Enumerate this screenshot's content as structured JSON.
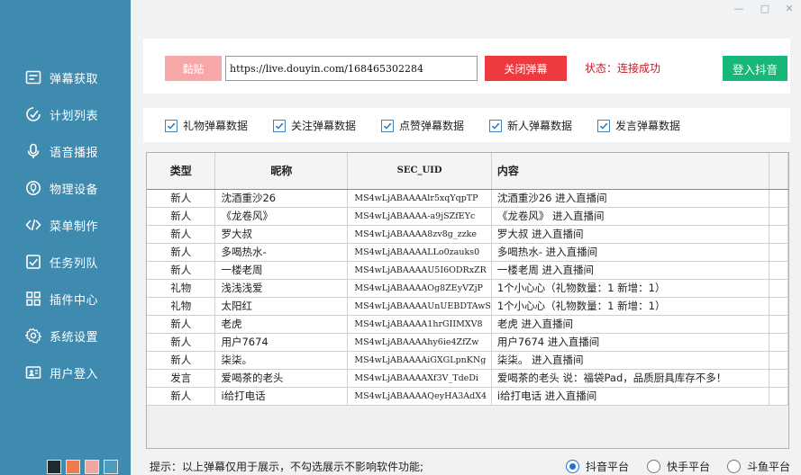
{
  "window": {
    "min_glyph": "—",
    "max_glyph": "□",
    "close_glyph": "✕"
  },
  "sidebar": {
    "items": [
      {
        "label": "弹幕获取",
        "icon": "danmaku-icon"
      },
      {
        "label": "计划列表",
        "icon": "plan-list-icon"
      },
      {
        "label": "语音播报",
        "icon": "microphone-icon"
      },
      {
        "label": "物理设备",
        "icon": "device-icon"
      },
      {
        "label": "菜单制作",
        "icon": "code-icon"
      },
      {
        "label": "任务列队",
        "icon": "task-queue-icon"
      },
      {
        "label": "插件中心",
        "icon": "plugin-grid-icon"
      },
      {
        "label": "系统设置",
        "icon": "gear-icon"
      },
      {
        "label": "用户登入",
        "icon": "user-card-icon"
      }
    ],
    "swatches": [
      "#1f2a33",
      "#f07b4a",
      "#f0a7a0",
      "#4f9bbd"
    ]
  },
  "top": {
    "paste_label": "黏贴",
    "url_value": "https://live.douyin.com/168465302284",
    "close_label": "关闭弹幕",
    "status_text": "状态：连接成功",
    "login_label": "登入抖音",
    "colors": {
      "paste": "#f7a7a8",
      "close": "#ee3a3f",
      "login": "#17b877",
      "status": "#c0202a"
    }
  },
  "filters": [
    {
      "label": "礼物弹幕数据",
      "checked": true
    },
    {
      "label": "关注弹幕数据",
      "checked": true
    },
    {
      "label": "点赞弹幕数据",
      "checked": true
    },
    {
      "label": "新人弹幕数据",
      "checked": true
    },
    {
      "label": "发言弹幕数据",
      "checked": true
    }
  ],
  "table": {
    "headers": [
      "类型",
      "昵称",
      "SEC_UID",
      "内容"
    ],
    "rows": [
      [
        "新人",
        "沈酒重沙26",
        "MS4wLjABAAAAlr5xqYqpTP",
        "沈酒重沙26 进入直播间"
      ],
      [
        "新人",
        "《龙卷风》",
        "MS4wLjABAAAA-a9jSZfEYc",
        "《龙卷风》 进入直播间"
      ],
      [
        "新人",
        "罗大叔",
        "MS4wLjABAAAA8zv8g_zzke",
        "罗大叔 进入直播间"
      ],
      [
        "新人",
        "多喝热水-",
        "MS4wLjABAAAALLo0zauks0",
        "多喝热水- 进入直播间"
      ],
      [
        "新人",
        "一楼老周",
        "MS4wLjABAAAAU5I6ODRxZR",
        "一楼老周 进入直播间"
      ],
      [
        "礼物",
        "浅浅浅爱",
        "MS4wLjABAAAAOg8ZEyVZjP",
        "1个小心心（礼物数量：1 新增：1）"
      ],
      [
        "礼物",
        "太阳红",
        "MS4wLjABAAAAUnUEBDTAwS",
        "1个小心心（礼物数量：1 新增：1）"
      ],
      [
        "新人",
        "老虎",
        "MS4wLjABAAAA1hrGIIMXV8",
        "老虎 进入直播间"
      ],
      [
        "新人",
        "用户7674",
        "MS4wLjABAAAAhy6ie4ZfZw",
        "用户7674 进入直播间"
      ],
      [
        "新人",
        "柒柒。",
        "MS4wLjABAAAAiGXGLpnKNg",
        "柒柒。 进入直播间"
      ],
      [
        "发言",
        "爱喝茶的老头",
        "MS4wLjABAAAAXf3V_TdeDi",
        "爱喝茶的老头  说：福袋Pad，品质厨具库存不多！"
      ],
      [
        "新人",
        "i给打电话",
        "MS4wLjABAAAAQeyHA3AdX4",
        "i给打电话 进入直播间"
      ]
    ]
  },
  "footer": {
    "hint": "提示：以上弹幕仅用于展示，不勾选展示不影响软件功能;",
    "platforms": [
      {
        "label": "抖音平台",
        "selected": true
      },
      {
        "label": "快手平台",
        "selected": false
      },
      {
        "label": "斗鱼平台",
        "selected": false
      }
    ]
  }
}
